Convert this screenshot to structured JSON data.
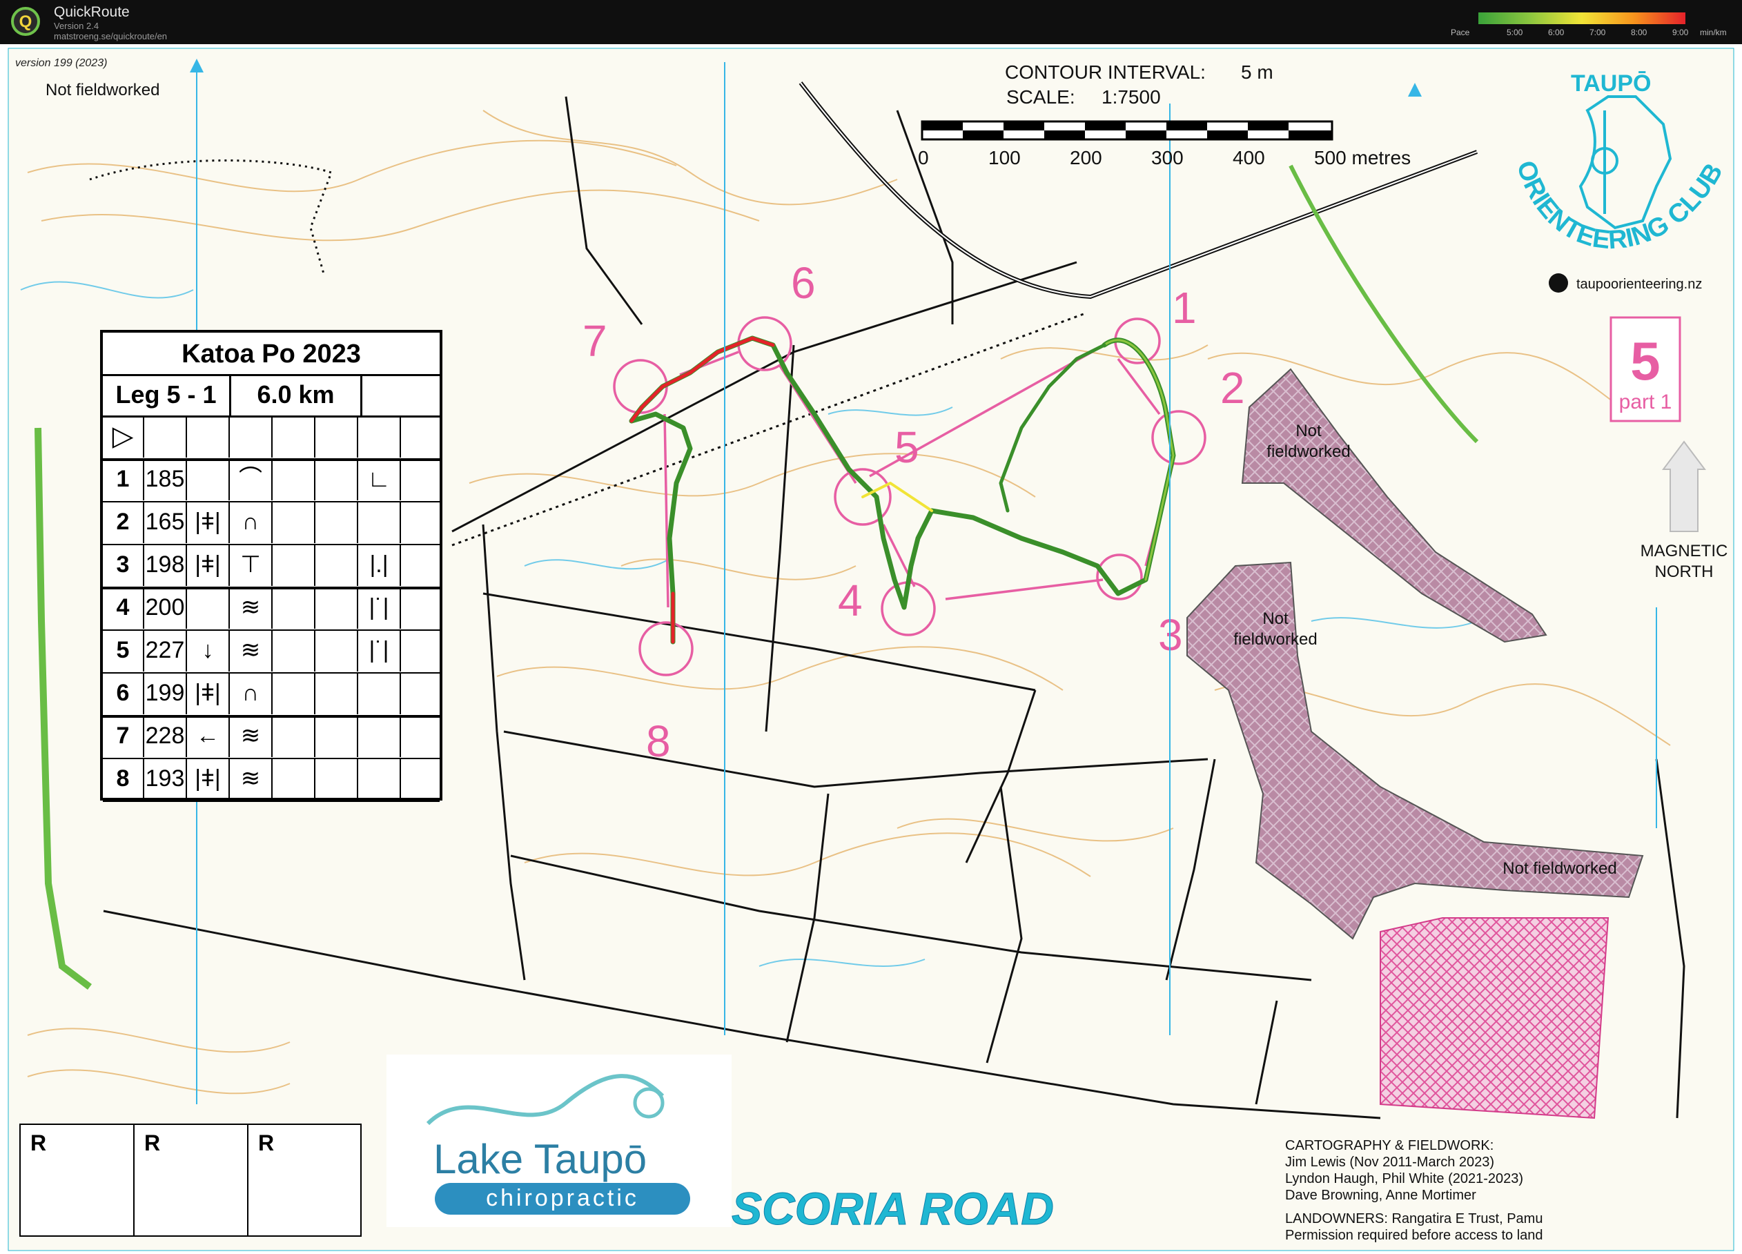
{
  "app": {
    "name": "QuickRoute",
    "version": "Version 2.4",
    "url": "matstroeng.se/quickroute/en"
  },
  "pace_scale": {
    "label": "Pace",
    "ticks": [
      "5:00",
      "6:00",
      "7:00",
      "8:00",
      "9:00"
    ],
    "unit": "min/km",
    "colors": [
      "#3aa23a",
      "#8cc63f",
      "#f1e437",
      "#f7941d",
      "#e5222a"
    ]
  },
  "map": {
    "version_note": "version 199 (2023)",
    "not_fieldworked": "Not fieldworked",
    "contour_label": "CONTOUR INTERVAL:",
    "contour_value": "5 m",
    "scale_label": "SCALE:",
    "scale_value": "1:7500",
    "scalebar_ticks": [
      "0",
      "100",
      "200",
      "300",
      "400",
      "500 metres"
    ],
    "club_name_top": "TAUPŌ",
    "club_name_arc": "ORIENTEERING CLUB",
    "club_website": "taupoorienteering.nz",
    "course_number": "5",
    "course_part": "part 1",
    "magnetic_north": [
      "MAGNETIC",
      "NORTH"
    ],
    "area_name": "SCORIA ROAD",
    "nf_areas": [
      [
        "Not",
        "fieldworked"
      ],
      [
        "Not",
        "fieldworked"
      ]
    ],
    "controls": [
      "1",
      "2",
      "3",
      "4",
      "5",
      "6",
      "7",
      "8"
    ],
    "credits": [
      "CARTOGRAPHY & FIELDWORK:",
      "Jim Lewis (Nov 2011-March 2023)",
      "Lyndon Haugh, Phil White (2021-2023)",
      "Dave Browning, Anne Mortimer",
      "LANDOWNERS:  Rangatira E Trust, Pamu",
      "Permission required before access to land"
    ],
    "sponsor": {
      "line1": "Lake Taupō",
      "line2": "chiropractic"
    },
    "r_boxes": [
      "R",
      "R",
      "R"
    ]
  },
  "legend": {
    "title": "Katoa Po 2023",
    "leg": "Leg 5 - 1",
    "distance": "6.0 km",
    "start_symbol": "▷",
    "rows": [
      {
        "num": "1",
        "code": "185",
        "d": "",
        "e": "⌒",
        "h": "∟"
      },
      {
        "num": "2",
        "code": "165",
        "d": "|ǂ|",
        "e": "∩",
        "h": ""
      },
      {
        "num": "3",
        "code": "198",
        "d": "|ǂ|",
        "e": "⊤",
        "h": "|.|"
      },
      {
        "num": "4",
        "code": "200",
        "d": "",
        "e": "≋",
        "h": "|˙|"
      },
      {
        "num": "5",
        "code": "227",
        "d": "↓",
        "e": "≋",
        "h": "|˙|"
      },
      {
        "num": "6",
        "code": "199",
        "d": "|ǂ|",
        "e": "∩",
        "h": ""
      },
      {
        "num": "7",
        "code": "228",
        "d": "←",
        "e": "≋",
        "h": ""
      },
      {
        "num": "8",
        "code": "193",
        "d": "|ǂ|",
        "e": "≋",
        "h": ""
      }
    ]
  }
}
